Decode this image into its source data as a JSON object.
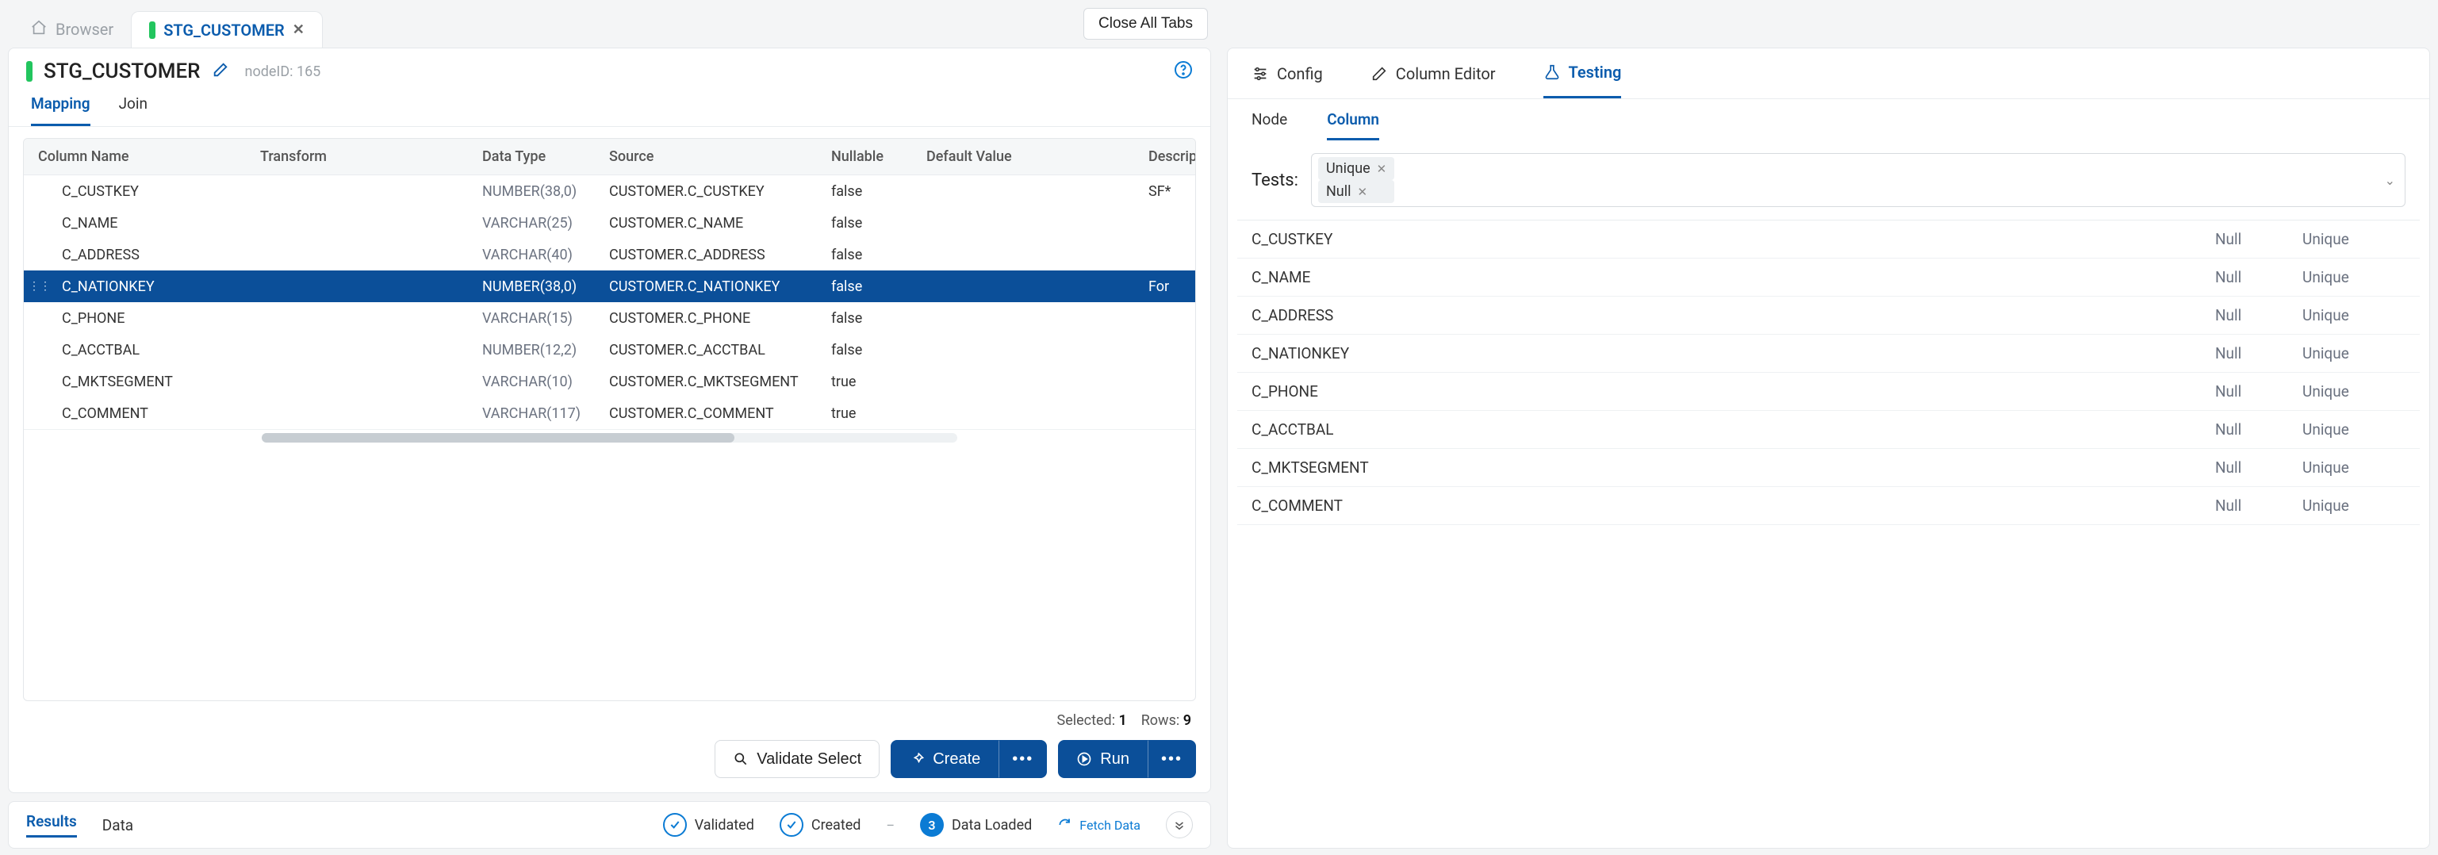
{
  "tabs": {
    "browser_label": "Browser",
    "active_label": "STG_CUSTOMER",
    "close_all": "Close All Tabs"
  },
  "header": {
    "title": "STG_CUSTOMER",
    "node_id": "nodeID: 165"
  },
  "left_tabs": {
    "mapping": "Mapping",
    "join": "Join"
  },
  "columns_header": {
    "name": "Column Name",
    "transform": "Transform",
    "dtype": "Data Type",
    "source": "Source",
    "nullable": "Nullable",
    "default": "Default Value",
    "description": "Descript"
  },
  "rows": [
    {
      "name": "C_CUSTKEY",
      "dtype": "NUMBER(38,0)",
      "source": "CUSTOMER.C_CUSTKEY",
      "nullable": "false",
      "desc": "SF*"
    },
    {
      "name": "C_NAME",
      "dtype": "VARCHAR(25)",
      "source": "CUSTOMER.C_NAME",
      "nullable": "false",
      "desc": ""
    },
    {
      "name": "C_ADDRESS",
      "dtype": "VARCHAR(40)",
      "source": "CUSTOMER.C_ADDRESS",
      "nullable": "false",
      "desc": ""
    },
    {
      "name": "C_NATIONKEY",
      "dtype": "NUMBER(38,0)",
      "source": "CUSTOMER.C_NATIONKEY",
      "nullable": "false",
      "desc": "For"
    },
    {
      "name": "C_PHONE",
      "dtype": "VARCHAR(15)",
      "source": "CUSTOMER.C_PHONE",
      "nullable": "false",
      "desc": ""
    },
    {
      "name": "C_ACCTBAL",
      "dtype": "NUMBER(12,2)",
      "source": "CUSTOMER.C_ACCTBAL",
      "nullable": "false",
      "desc": ""
    },
    {
      "name": "C_MKTSEGMENT",
      "dtype": "VARCHAR(10)",
      "source": "CUSTOMER.C_MKTSEGMENT",
      "nullable": "true",
      "desc": ""
    },
    {
      "name": "C_COMMENT",
      "dtype": "VARCHAR(117)",
      "source": "CUSTOMER.C_COMMENT",
      "nullable": "true",
      "desc": ""
    }
  ],
  "selected_row_index": 3,
  "footer": {
    "selected_label": "Selected:",
    "selected": "1",
    "rows_label": "Rows:",
    "rows": "9"
  },
  "actions": {
    "validate": "Validate Select",
    "create": "Create",
    "run": "Run"
  },
  "results_tabs": {
    "results": "Results",
    "data": "Data"
  },
  "status": {
    "validated": "Validated",
    "created": "Created",
    "loaded_count": "3",
    "loaded": "Data Loaded",
    "fetch": "Fetch Data"
  },
  "right_tabs": {
    "config": "Config",
    "column_editor": "Column Editor",
    "testing": "Testing"
  },
  "right_sub": {
    "node": "Node",
    "column": "Column"
  },
  "tests_label": "Tests:",
  "test_tags": [
    "Unique",
    "Null"
  ],
  "test_headers": {
    "null": "Null",
    "unique": "Unique"
  },
  "test_rows": [
    "C_CUSTKEY",
    "C_NAME",
    "C_ADDRESS",
    "C_NATIONKEY",
    "C_PHONE",
    "C_ACCTBAL",
    "C_MKTSEGMENT",
    "C_COMMENT"
  ]
}
